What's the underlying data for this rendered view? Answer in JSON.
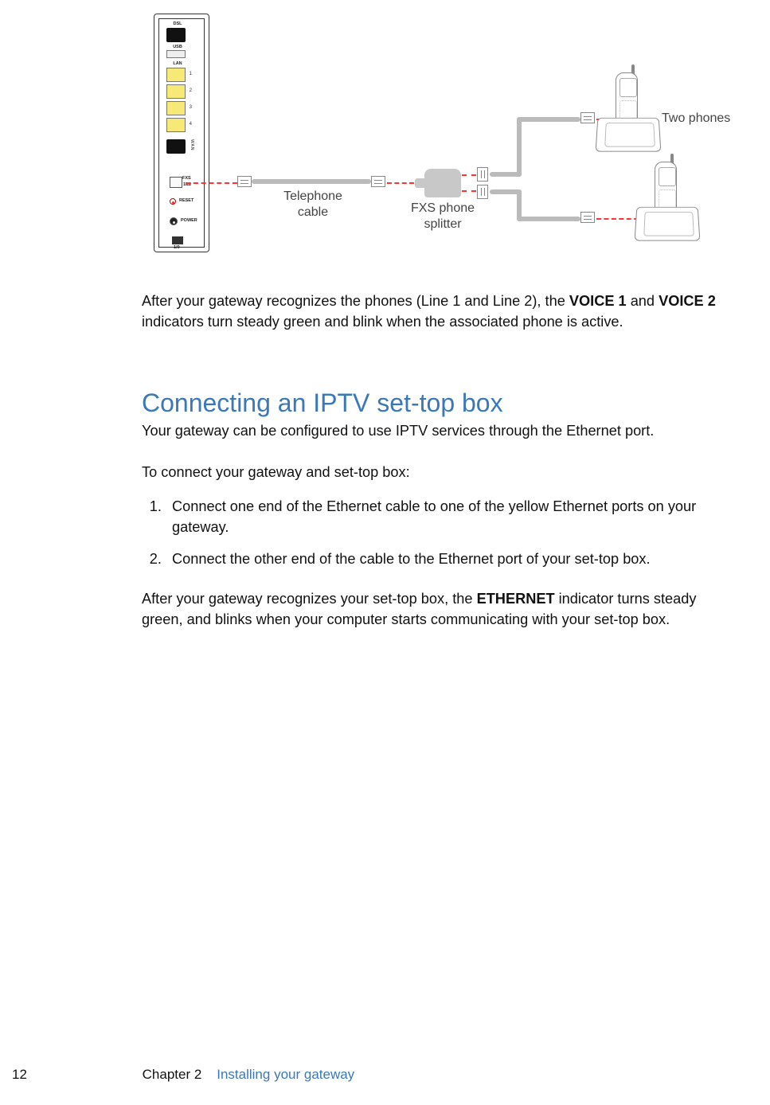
{
  "diagram": {
    "gateway_ports": {
      "dsl": "DSL",
      "usb": "USB",
      "lan": "LAN",
      "lan_numbers": [
        "1",
        "2",
        "3",
        "4"
      ],
      "wan": "WAN",
      "fxs": "FXS",
      "fxs_sub": "1&2",
      "reset": "RESET",
      "power": "POWER",
      "bottom": "1/0"
    },
    "telephone_cable_label": "Telephone\ncable",
    "splitter_label": "FXS phone\nsplitter",
    "two_phones_label": "Two phones"
  },
  "body": {
    "voice_para_pre": "After your gateway recognizes the phones (Line 1 and Line 2), the ",
    "voice1_strong": "VOICE 1",
    "voice_para_mid": " and ",
    "voice2_strong": "VOICE 2",
    "voice_para_post": " indicators turn steady green and blink when the associated phone is active."
  },
  "section": {
    "title": "Connecting an IPTV set-top box",
    "intro": "Your gateway can be configured to use IPTV services through the Ethernet port.",
    "lead": "To connect your gateway and set-top box:",
    "steps": [
      "Connect one end of the Ethernet cable to one of the yellow Ethernet ports on your gateway.",
      "Connect the other end of the cable to the Ethernet port of your set-top box."
    ],
    "after_pre": "After your gateway recognizes your set-top box, the ",
    "after_strong": "ETHERNET",
    "after_post": " indicator turns steady green, and blinks when your computer starts communicating with your set-top box."
  },
  "footer": {
    "page_number": "12",
    "chapter_label": "Chapter 2",
    "chapter_title": "Installing your gateway"
  }
}
